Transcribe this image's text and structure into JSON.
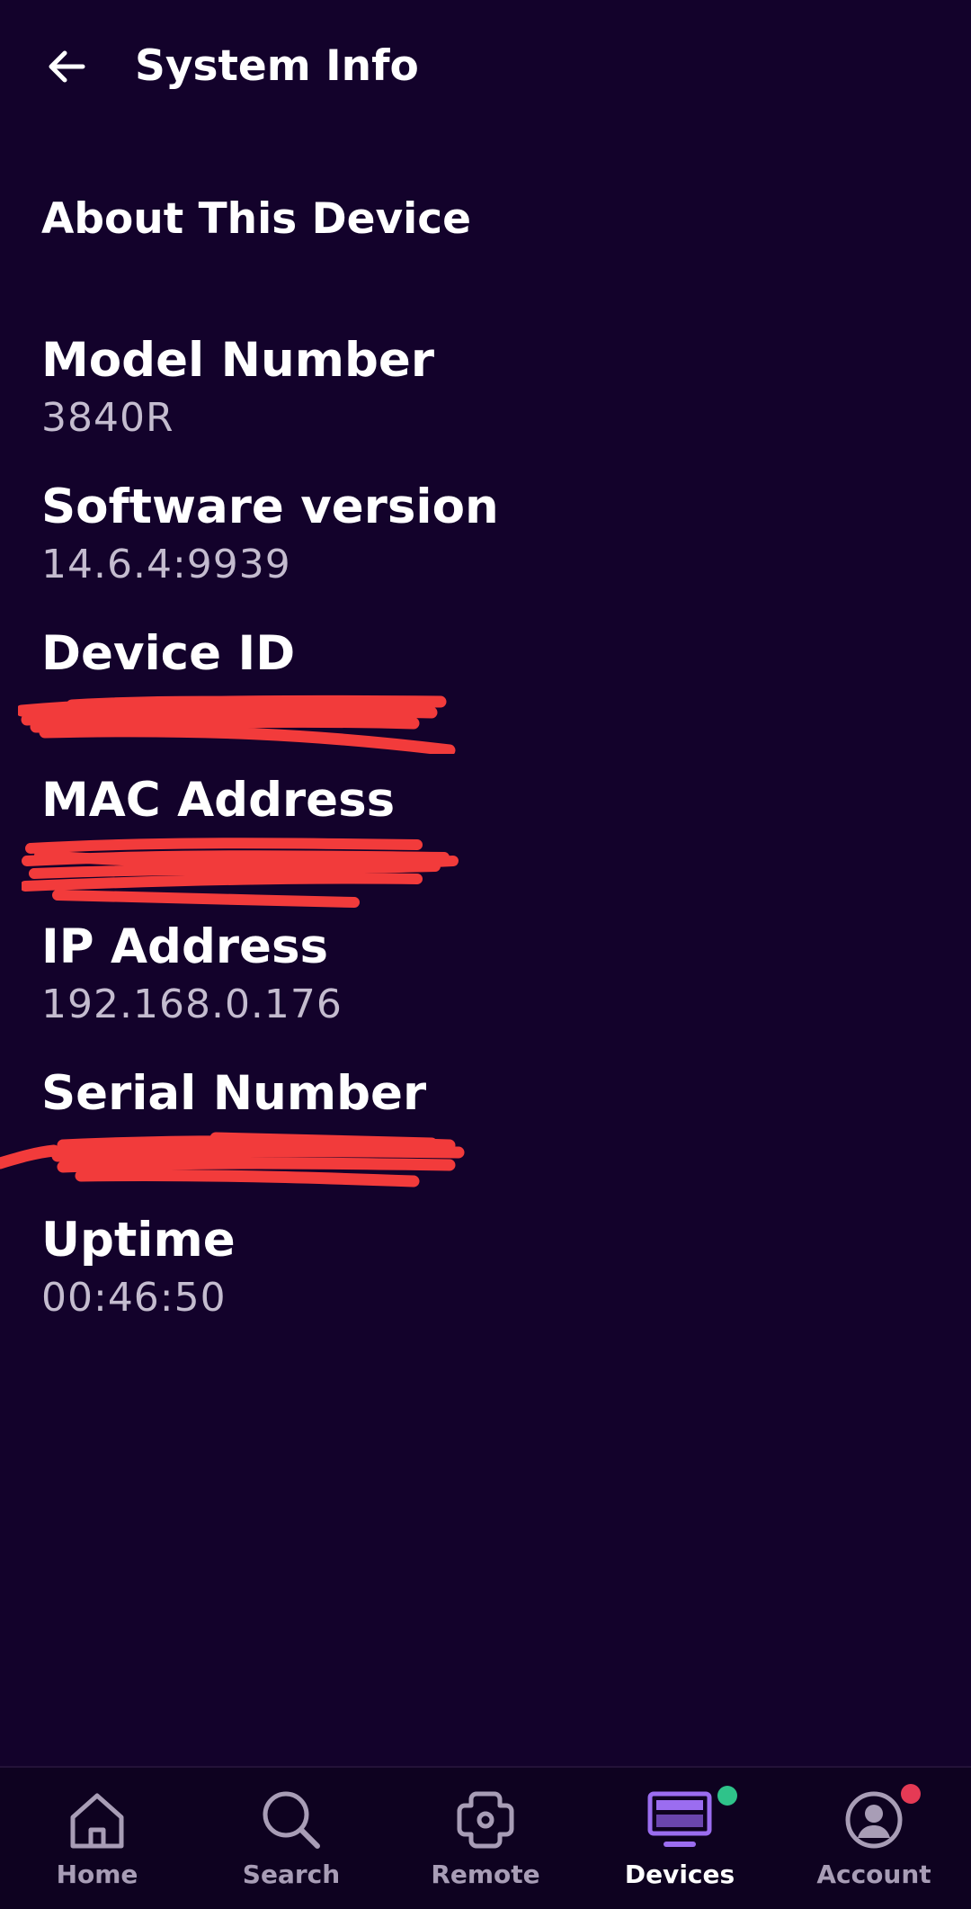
{
  "header": {
    "title": "System Info"
  },
  "section": {
    "title": "About This Device"
  },
  "info": [
    {
      "label": "Model Number",
      "value": "3840R"
    },
    {
      "label": "Software version",
      "value": "14.6.4:9939"
    },
    {
      "label": "Device ID",
      "value": ""
    },
    {
      "label": "MAC Address",
      "value": ""
    },
    {
      "label": "IP Address",
      "value": "192.168.0.176"
    },
    {
      "label": "Serial Number",
      "value": ""
    },
    {
      "label": "Uptime",
      "value": "00:46:50"
    }
  ],
  "nav": {
    "items": [
      {
        "label": "Home",
        "icon": "home-icon"
      },
      {
        "label": "Search",
        "icon": "search-icon"
      },
      {
        "label": "Remote",
        "icon": "remote-icon"
      },
      {
        "label": "Devices",
        "icon": "devices-icon",
        "active": true,
        "badge_color": "#2fc38a"
      },
      {
        "label": "Account",
        "icon": "account-icon",
        "badge_color": "#e53a55"
      }
    ]
  },
  "colors": {
    "background": "#13022b",
    "nav_background": "#0e0220",
    "accent": "#9b6df0",
    "redaction": "#f23b3b",
    "value_text": "#c4bccf"
  }
}
